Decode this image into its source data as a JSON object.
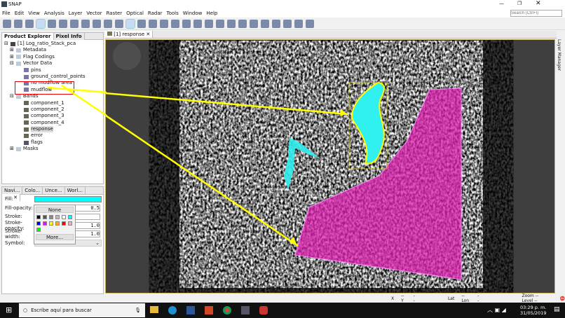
{
  "window": {
    "title": "SNAP",
    "search_placeholder": "Search (Ctrl+I)"
  },
  "menu": [
    "File",
    "Edit",
    "View",
    "Analysis",
    "Layer",
    "Vector",
    "Raster",
    "Optical",
    "Radar",
    "Tools",
    "Window",
    "Help"
  ],
  "explorer": {
    "tabs": [
      "Product Explorer",
      "Pixel Info"
    ],
    "product": "[1] Log_ratio_Stack_pca",
    "nodes": [
      "Metadata",
      "Flag Codings",
      "Vector Data"
    ],
    "vectors": [
      "pins",
      "ground_control_points",
      "no mudflow area",
      "mudflow"
    ],
    "bands_label": "Bands",
    "bands": [
      "component_1",
      "component_2",
      "component_3",
      "component_4",
      "response",
      "error",
      "flags"
    ],
    "masks": "Masks"
  },
  "layer_panel": {
    "tabs": [
      "Navi...",
      "Colo...",
      "Unce...",
      "Worl..."
    ],
    "fill_label": "Fill:",
    "fill_color": "#00ffff",
    "fill_opacity_label": "Fill-opacity:",
    "fill_opacity": "0.5",
    "stroke_label": "Stroke:",
    "stroke_opacity_label": "Stroke-opacity:",
    "stroke_opacity": "1.0",
    "stroke_width_label": "Stroke-width:",
    "stroke_width": "1.0",
    "symbol_label": "Symbol:",
    "symbol": "cross",
    "popup": {
      "none": "None",
      "more": "More...",
      "colors": [
        "#000000",
        "#555555",
        "#888888",
        "#bbbbbb",
        "#ffffff",
        "#00ffff",
        "#0000ff",
        "#ff00ff",
        "#ffff00",
        "#ffb000",
        "#ff0000",
        "#ffaaaa",
        "#00ff00"
      ]
    }
  },
  "view": {
    "tab": "[1] response",
    "right_tab": "Layer Manager"
  },
  "status": {
    "x": "X",
    "y": "-- Y",
    "yv": "--",
    "lat": "Lat",
    "lon": "-- Lon",
    "lonv": "--",
    "zoom": "Zoom -- Level --"
  },
  "taskbar": {
    "search": "Escribe aquí para buscar",
    "time": "03:29 p. m.",
    "date": "31/05/2019"
  }
}
